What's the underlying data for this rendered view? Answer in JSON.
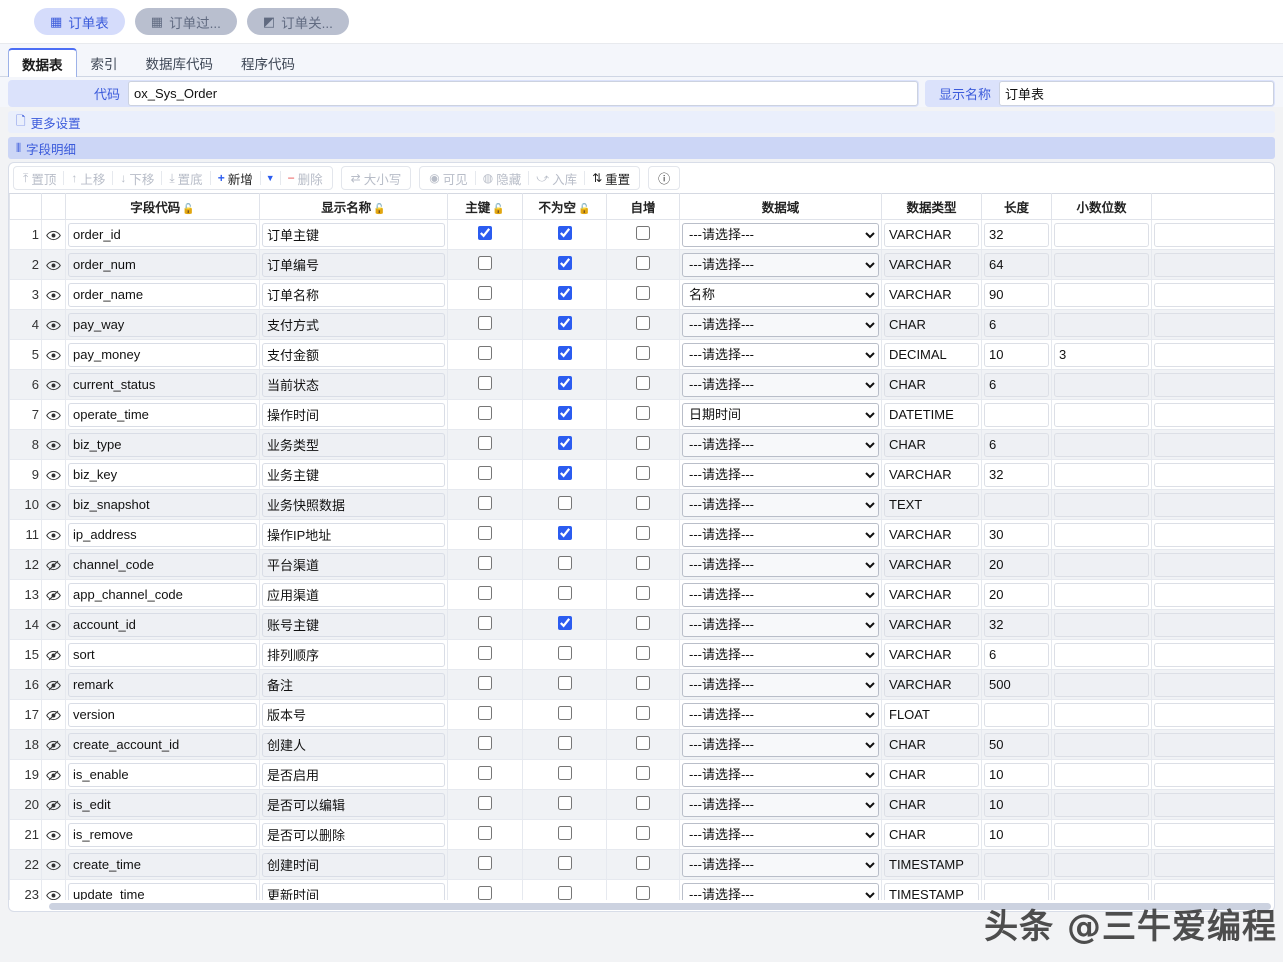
{
  "top_tabs": [
    {
      "label": "订单表",
      "icon": "table-icon",
      "icon_glyph": "▦",
      "state": "active"
    },
    {
      "label": "订单过...",
      "icon": "table-icon",
      "icon_glyph": "▦",
      "state": "idle"
    },
    {
      "label": "订单关...",
      "icon": "relation-icon",
      "icon_glyph": "◩",
      "state": "idle"
    }
  ],
  "sub_tabs": [
    {
      "label": "数据表",
      "state": "active"
    },
    {
      "label": "索引",
      "state": "idle"
    },
    {
      "label": "数据库代码",
      "state": "idle"
    },
    {
      "label": "程序代码",
      "state": "idle"
    }
  ],
  "form": {
    "code_label": "代码",
    "code_value": "ox_Sys_Order",
    "display_label": "显示名称",
    "display_value": "订单表"
  },
  "banners": {
    "more_settings": "更多设置",
    "more_settings_icon": "document-icon",
    "field_detail": "字段明细",
    "field_detail_icon": "columns-icon"
  },
  "toolbar": {
    "group1": [
      {
        "label": "置顶",
        "icon": "arrow-to-top-icon",
        "glyph": "⤒",
        "enabled": false
      },
      {
        "label": "上移",
        "icon": "arrow-up-icon",
        "glyph": "↑",
        "enabled": false
      },
      {
        "label": "下移",
        "icon": "arrow-down-icon",
        "glyph": "↓",
        "enabled": false
      },
      {
        "label": "置底",
        "icon": "arrow-to-bottom-icon",
        "glyph": "⤓",
        "enabled": false
      },
      {
        "label": "新增",
        "icon": "plus-icon",
        "glyph": "+",
        "enabled": true
      },
      {
        "label": "删除",
        "icon": "minus-icon",
        "glyph": "−",
        "enabled": false
      }
    ],
    "group2": [
      {
        "label": "大小写",
        "icon": "swap-case-icon",
        "glyph": "⇄",
        "enabled": false
      }
    ],
    "group3": [
      {
        "label": "可见",
        "icon": "eye-icon",
        "glyph": "◉",
        "enabled": false
      },
      {
        "label": "隐藏",
        "icon": "eye-off-icon",
        "glyph": "◍",
        "enabled": false
      },
      {
        "label": "入库",
        "icon": "import-icon",
        "glyph": "⤻",
        "enabled": false
      },
      {
        "label": "重置",
        "icon": "sort-reset-icon",
        "glyph": "⇅",
        "enabled": true
      }
    ],
    "group4": [
      {
        "label": "",
        "icon": "info-icon",
        "glyph": "ⓘ",
        "enabled": true
      }
    ]
  },
  "grid": {
    "columns": [
      {
        "key": "index",
        "label": ""
      },
      {
        "key": "visible",
        "label": ""
      },
      {
        "key": "field_code",
        "label": "字段代码",
        "lock": "🔓"
      },
      {
        "key": "display_name",
        "label": "显示名称",
        "lock": "🔓"
      },
      {
        "key": "primary_key",
        "label": "主键",
        "lock": "🔓"
      },
      {
        "key": "not_null",
        "label": "不为空",
        "lock": "🔓"
      },
      {
        "key": "auto_increment",
        "label": "自增"
      },
      {
        "key": "data_domain",
        "label": "数据域"
      },
      {
        "key": "data_type",
        "label": "数据类型"
      },
      {
        "key": "length",
        "label": "长度"
      },
      {
        "key": "decimals",
        "label": "小数位数"
      },
      {
        "key": "extra",
        "label": ""
      }
    ],
    "domain_placeholder": "---请选择---",
    "rows": [
      {
        "index": "1",
        "visible": "eye-icon",
        "field_code": "order_id",
        "display_name": "订单主键",
        "primary_key": true,
        "not_null": true,
        "auto_increment": false,
        "data_domain": "---请选择---",
        "data_type": "VARCHAR",
        "length": "32",
        "decimals": ""
      },
      {
        "index": "2",
        "visible": "eye-icon",
        "field_code": "order_num",
        "display_name": "订单编号",
        "primary_key": false,
        "not_null": true,
        "auto_increment": false,
        "data_domain": "---请选择---",
        "data_type": "VARCHAR",
        "length": "64",
        "decimals": ""
      },
      {
        "index": "3",
        "visible": "eye-icon",
        "field_code": "order_name",
        "display_name": "订单名称",
        "primary_key": false,
        "not_null": true,
        "auto_increment": false,
        "data_domain": "名称",
        "data_type": "VARCHAR",
        "length": "90",
        "decimals": ""
      },
      {
        "index": "4",
        "visible": "eye-icon",
        "field_code": "pay_way",
        "display_name": "支付方式",
        "primary_key": false,
        "not_null": true,
        "auto_increment": false,
        "data_domain": "---请选择---",
        "data_type": "CHAR",
        "length": "6",
        "decimals": ""
      },
      {
        "index": "5",
        "visible": "eye-icon",
        "field_code": "pay_money",
        "display_name": "支付金额",
        "primary_key": false,
        "not_null": true,
        "auto_increment": false,
        "data_domain": "---请选择---",
        "data_type": "DECIMAL",
        "length": "10",
        "decimals": "3"
      },
      {
        "index": "6",
        "visible": "eye-icon",
        "field_code": "current_status",
        "display_name": "当前状态",
        "primary_key": false,
        "not_null": true,
        "auto_increment": false,
        "data_domain": "---请选择---",
        "data_type": "CHAR",
        "length": "6",
        "decimals": ""
      },
      {
        "index": "7",
        "visible": "eye-icon",
        "field_code": "operate_time",
        "display_name": "操作时间",
        "primary_key": false,
        "not_null": true,
        "auto_increment": false,
        "data_domain": "日期时间",
        "data_type": "DATETIME",
        "length": "",
        "decimals": ""
      },
      {
        "index": "8",
        "visible": "eye-icon",
        "field_code": "biz_type",
        "display_name": "业务类型",
        "primary_key": false,
        "not_null": true,
        "auto_increment": false,
        "data_domain": "---请选择---",
        "data_type": "CHAR",
        "length": "6",
        "decimals": ""
      },
      {
        "index": "9",
        "visible": "eye-icon",
        "field_code": "biz_key",
        "display_name": "业务主键",
        "primary_key": false,
        "not_null": true,
        "auto_increment": false,
        "data_domain": "---请选择---",
        "data_type": "VARCHAR",
        "length": "32",
        "decimals": ""
      },
      {
        "index": "10",
        "visible": "eye-icon",
        "field_code": "biz_snapshot",
        "display_name": "业务快照数据",
        "primary_key": false,
        "not_null": false,
        "auto_increment": false,
        "data_domain": "---请选择---",
        "data_type": "TEXT",
        "length": "",
        "decimals": ""
      },
      {
        "index": "11",
        "visible": "eye-icon",
        "field_code": "ip_address",
        "display_name": "操作IP地址",
        "primary_key": false,
        "not_null": true,
        "auto_increment": false,
        "data_domain": "---请选择---",
        "data_type": "VARCHAR",
        "length": "30",
        "decimals": ""
      },
      {
        "index": "12",
        "visible": "eye-off-icon",
        "field_code": "channel_code",
        "display_name": "平台渠道",
        "primary_key": false,
        "not_null": false,
        "auto_increment": false,
        "data_domain": "---请选择---",
        "data_type": "VARCHAR",
        "length": "20",
        "decimals": ""
      },
      {
        "index": "13",
        "visible": "eye-off-icon",
        "field_code": "app_channel_code",
        "display_name": "应用渠道",
        "primary_key": false,
        "not_null": false,
        "auto_increment": false,
        "data_domain": "---请选择---",
        "data_type": "VARCHAR",
        "length": "20",
        "decimals": ""
      },
      {
        "index": "14",
        "visible": "eye-icon",
        "field_code": "account_id",
        "display_name": "账号主键",
        "primary_key": false,
        "not_null": true,
        "auto_increment": false,
        "data_domain": "---请选择---",
        "data_type": "VARCHAR",
        "length": "32",
        "decimals": ""
      },
      {
        "index": "15",
        "visible": "eye-off-icon",
        "field_code": "sort",
        "display_name": "排列顺序",
        "primary_key": false,
        "not_null": false,
        "auto_increment": false,
        "data_domain": "---请选择---",
        "data_type": "VARCHAR",
        "length": "6",
        "decimals": ""
      },
      {
        "index": "16",
        "visible": "eye-off-icon",
        "field_code": "remark",
        "display_name": "备注",
        "primary_key": false,
        "not_null": false,
        "auto_increment": false,
        "data_domain": "---请选择---",
        "data_type": "VARCHAR",
        "length": "500",
        "decimals": ""
      },
      {
        "index": "17",
        "visible": "eye-off-icon",
        "field_code": "version",
        "display_name": "版本号",
        "primary_key": false,
        "not_null": false,
        "auto_increment": false,
        "data_domain": "---请选择---",
        "data_type": "FLOAT",
        "length": "",
        "decimals": ""
      },
      {
        "index": "18",
        "visible": "eye-off-icon",
        "field_code": "create_account_id",
        "display_name": "创建人",
        "primary_key": false,
        "not_null": false,
        "auto_increment": false,
        "data_domain": "---请选择---",
        "data_type": "CHAR",
        "length": "50",
        "decimals": ""
      },
      {
        "index": "19",
        "visible": "eye-off-icon",
        "field_code": "is_enable",
        "display_name": "是否启用",
        "primary_key": false,
        "not_null": false,
        "auto_increment": false,
        "data_domain": "---请选择---",
        "data_type": "CHAR",
        "length": "10",
        "decimals": ""
      },
      {
        "index": "20",
        "visible": "eye-off-icon",
        "field_code": "is_edit",
        "display_name": "是否可以编辑",
        "primary_key": false,
        "not_null": false,
        "auto_increment": false,
        "data_domain": "---请选择---",
        "data_type": "CHAR",
        "length": "10",
        "decimals": ""
      },
      {
        "index": "21",
        "visible": "eye-icon",
        "field_code": "is_remove",
        "display_name": "是否可以删除",
        "primary_key": false,
        "not_null": false,
        "auto_increment": false,
        "data_domain": "---请选择---",
        "data_type": "CHAR",
        "length": "10",
        "decimals": ""
      },
      {
        "index": "22",
        "visible": "eye-icon",
        "field_code": "create_time",
        "display_name": "创建时间",
        "primary_key": false,
        "not_null": false,
        "auto_increment": false,
        "data_domain": "---请选择---",
        "data_type": "TIMESTAMP",
        "length": "",
        "decimals": ""
      },
      {
        "index": "23",
        "visible": "eye-icon",
        "field_code": "update_time",
        "display_name": "更新时间",
        "primary_key": false,
        "not_null": false,
        "auto_increment": false,
        "data_domain": "---请选择---",
        "data_type": "TIMESTAMP",
        "length": "",
        "decimals": ""
      }
    ]
  },
  "watermark": "头条 @三牛爱编程"
}
